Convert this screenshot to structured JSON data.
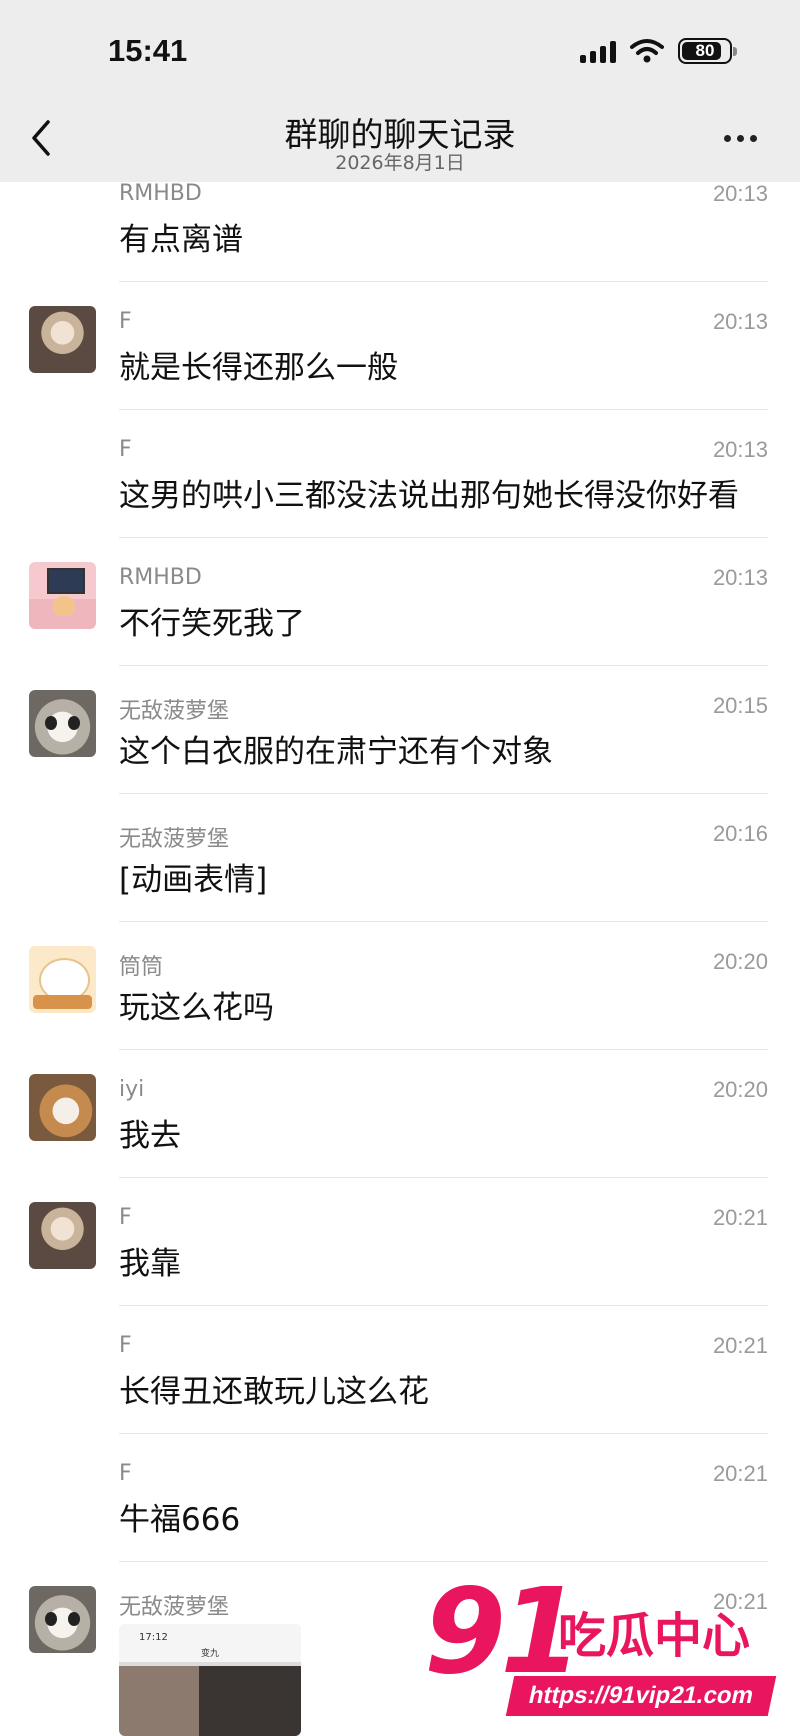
{
  "status_bar": {
    "time": "15:41",
    "battery": "80"
  },
  "nav": {
    "title": "群聊的聊天记录",
    "subtitle": "2026年8月1日"
  },
  "messages": [
    {
      "sender": "RMHBD",
      "time": "20:13",
      "text": "有点离谱",
      "avatar": "none"
    },
    {
      "sender": "F",
      "time": "20:13",
      "text": "就是长得还那么一般",
      "avatar": "girl"
    },
    {
      "sender": "F",
      "time": "20:13",
      "text": "这男的哄小三都没法说出那句她长得没你好看",
      "avatar": "none"
    },
    {
      "sender": "RMHBD",
      "time": "20:13",
      "text": "不行笑死我了",
      "avatar": "pink"
    },
    {
      "sender": "无敌菠萝堡",
      "time": "20:15",
      "text": "这个白衣服的在肃宁还有个对象",
      "avatar": "cat"
    },
    {
      "sender": "无敌菠萝堡",
      "time": "20:16",
      "text": "[动画表情]",
      "avatar": "none"
    },
    {
      "sender": "筒筒",
      "time": "20:20",
      "text": "玩这么花吗",
      "avatar": "bear"
    },
    {
      "sender": "iyi",
      "time": "20:20",
      "text": "我去",
      "avatar": "calico"
    },
    {
      "sender": "F",
      "time": "20:21",
      "text": "我靠",
      "avatar": "girl"
    },
    {
      "sender": "F",
      "time": "20:21",
      "text": "长得丑还敢玩儿这么花",
      "avatar": "none"
    },
    {
      "sender": "F",
      "time": "20:21",
      "text": "牛福666",
      "avatar": "none"
    },
    {
      "sender": "无敌菠萝堡",
      "time": "20:21",
      "text": "",
      "avatar": "cat"
    }
  ],
  "image_preview": {
    "time": "17:12",
    "title": "变九"
  },
  "watermark": {
    "number": "91",
    "name": "吃瓜中心",
    "url": "https://91vip21.com"
  },
  "colors": {
    "topbar": "#ededed",
    "watermark": "#e9155f"
  }
}
